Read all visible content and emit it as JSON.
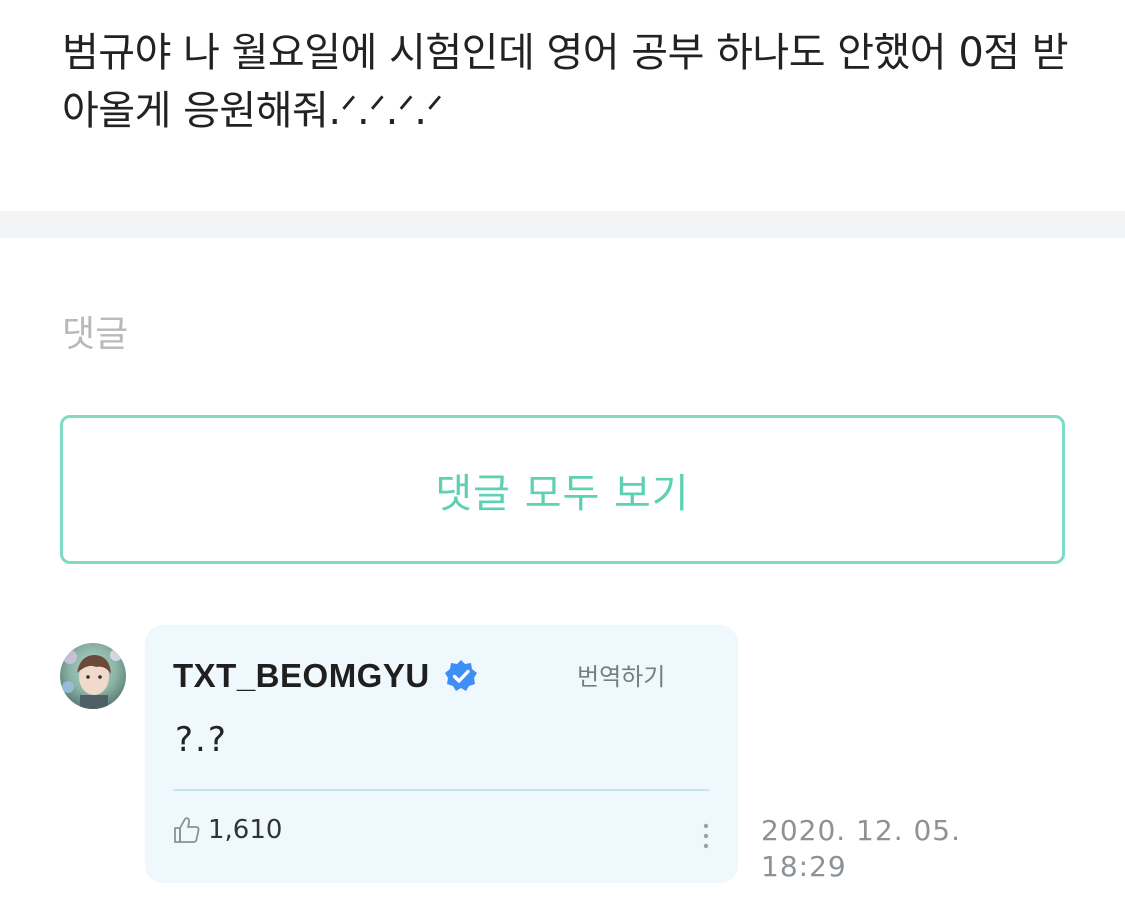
{
  "post": {
    "text": "범규야 나 월요일에 시험인데 영어 공부 하나도 안했어 0점 받아올게 응원해줘.ᐟ.ᐟ.ᐟ.ᐟ"
  },
  "comments_section": {
    "heading": "댓글",
    "view_all_label": "댓글 모두 보기"
  },
  "comment": {
    "author": "TXT_BEOMGYU",
    "verified_icon": "verified-check-icon",
    "translate_label": "번역하기",
    "body": "?.?",
    "like_icon": "thumbs-up-icon",
    "like_count": "1,610",
    "more_icon": "vertical-dots-icon",
    "date": "2020. 12. 05.",
    "time": "18:29"
  },
  "colors": {
    "accent": "#5fd1b3",
    "accent_border": "#7fdcc4",
    "bubble_bg": "#eff8fc",
    "verified": "#3e8ef7",
    "divider": "#f2f4f6"
  }
}
